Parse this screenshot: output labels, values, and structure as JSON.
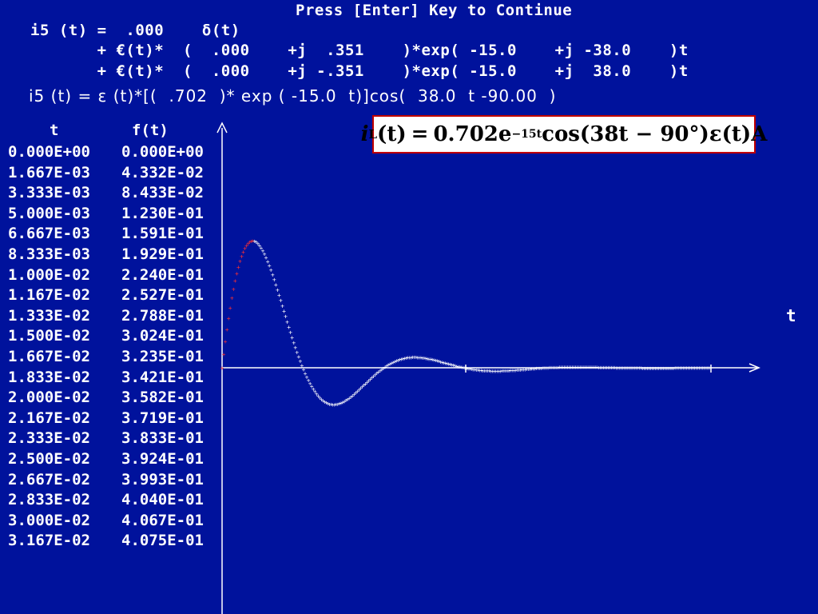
{
  "prompt": {
    "press_enter": "Press [Enter] Key to Continue"
  },
  "header": {
    "line1": "i5 (t) =  .000    δ(t)",
    "line2": "       + €(t)*  (  .000    +j  .351    )*exp( -15.0    +j -38.0    )t",
    "line3": "       + €(t)*  (  .000    +j -.351    )*exp( -15.0    +j  38.0    )t"
  },
  "result": {
    "expression": "i5 (t) = ε (t)*[(  .702  )* exp ( -15.0  t)]cos(  38.0  t -90.00  )"
  },
  "table": {
    "headers": {
      "t": "t",
      "f": "f(t)"
    },
    "rows": [
      {
        "t": "0.000E+00",
        "f": "0.000E+00"
      },
      {
        "t": "1.667E-03",
        "f": "4.332E-02"
      },
      {
        "t": "3.333E-03",
        "f": "8.433E-02"
      },
      {
        "t": "5.000E-03",
        "f": "1.230E-01"
      },
      {
        "t": "6.667E-03",
        "f": "1.591E-01"
      },
      {
        "t": "8.333E-03",
        "f": "1.929E-01"
      },
      {
        "t": "1.000E-02",
        "f": "2.240E-01"
      },
      {
        "t": "1.167E-02",
        "f": "2.527E-01"
      },
      {
        "t": "1.333E-02",
        "f": "2.788E-01"
      },
      {
        "t": "1.500E-02",
        "f": "3.024E-01"
      },
      {
        "t": "1.667E-02",
        "f": "3.235E-01"
      },
      {
        "t": "1.833E-02",
        "f": "3.421E-01"
      },
      {
        "t": "2.000E-02",
        "f": "3.582E-01"
      },
      {
        "t": "2.167E-02",
        "f": "3.719E-01"
      },
      {
        "t": "2.333E-02",
        "f": "3.833E-01"
      },
      {
        "t": "2.500E-02",
        "f": "3.924E-01"
      },
      {
        "t": "2.667E-02",
        "f": "3.993E-01"
      },
      {
        "t": "2.833E-02",
        "f": "4.040E-01"
      },
      {
        "t": "3.000E-02",
        "f": "4.067E-01"
      },
      {
        "t": "3.167E-02",
        "f": "4.075E-01"
      }
    ]
  },
  "formula_box": {
    "lhs_var": "i",
    "lhs_sub": "L",
    "lhs_arg": "(t)",
    "equals": "=",
    "coef": "0.702e",
    "exponent": "−15t",
    "rest": " cos(38t − 90°)ε(t)A"
  },
  "chart_data": {
    "type": "scatter",
    "title": "",
    "xlabel": "t",
    "ylabel": "",
    "function": "0.702*exp(-15t)*cos(38t - 90deg)",
    "x_range": [
      0,
      0.5
    ],
    "y_range": [
      -0.3,
      0.75
    ],
    "point_count": 300,
    "highlight_points": 20,
    "colors": {
      "highlight": "#ff3030",
      "points": "#ffffff",
      "axes": "#ffffff",
      "background": "#00129c"
    }
  }
}
